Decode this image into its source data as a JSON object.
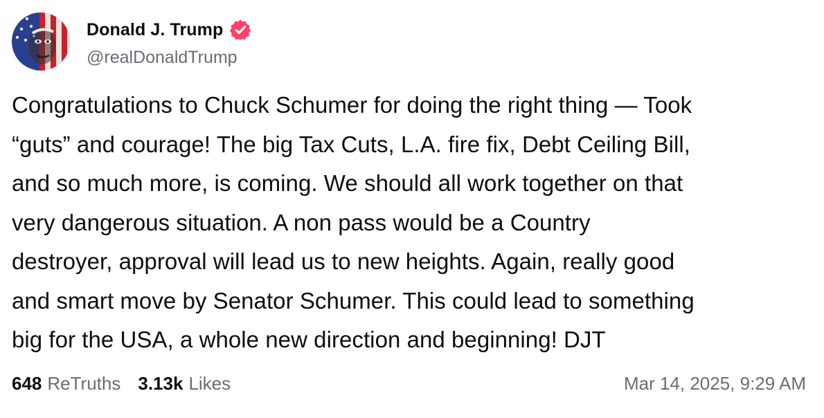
{
  "author": {
    "display_name": "Donald J. Trump",
    "handle": "@realDonaldTrump",
    "verified": true,
    "verified_color": "#ff3f6c"
  },
  "post": {
    "text": "Congratulations to Chuck Schumer for doing the right thing — Took “guts” and courage! The big Tax Cuts, L.A. fire fix, Debt Ceiling Bill, and so much more, is coming. We should all work together on that very dangerous situation. A non pass would be a Country destroyer, approval will lead us to new heights. Again, really good and smart move by Senator Schumer. This could lead to something big for the USA, a whole new direction and beginning! DJT",
    "lines": [
      "Congratulations to Chuck Schumer for doing the right thing — Took",
      "“guts” and courage! The big Tax Cuts, L.A. fire fix, Debt Ceiling Bill,",
      "and so much more, is coming. We should all work together on that",
      "very dangerous situation. A non pass would be a Country",
      "destroyer, approval will lead us to new heights. Again, really good",
      "and smart move by Senator Schumer. This could lead to something",
      "big for the USA, a whole new direction and beginning! DJT"
    ]
  },
  "stats": {
    "retruths_count": "648",
    "retruths_label": "ReTruths",
    "likes_count": "3.13k",
    "likes_label": "Likes"
  },
  "timestamp": "Mar 14, 2025, 9:29 AM",
  "icons": {
    "avatar": "avatar-image",
    "verified": "verified-badge-icon"
  }
}
